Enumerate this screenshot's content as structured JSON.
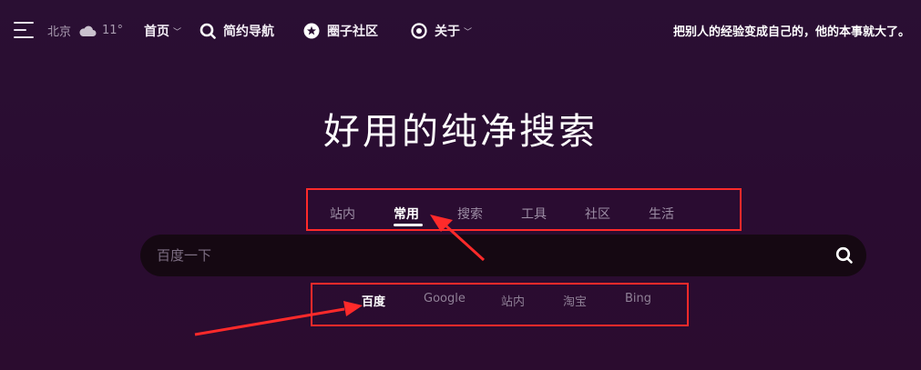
{
  "weather": {
    "city": "北京",
    "temp": "11°"
  },
  "nav": {
    "home": "首页",
    "simple_nav": "简约导航",
    "community": "圈子社区",
    "about": "关于"
  },
  "motto": "把别人的经验变成自己的，他的本事就大了。",
  "hero": {
    "title": "好用的纯净搜索"
  },
  "tabs": [
    "站内",
    "常用",
    "搜索",
    "工具",
    "社区",
    "生活"
  ],
  "active_tab": "常用",
  "search": {
    "placeholder": "百度一下",
    "value": ""
  },
  "engines": [
    "百度",
    "Google",
    "站内",
    "淘宝",
    "Bing"
  ],
  "active_engine": "百度",
  "colors": {
    "highlight_box": "#ff2a2a",
    "background": "#2a0f33",
    "search_bg": "#150812"
  }
}
